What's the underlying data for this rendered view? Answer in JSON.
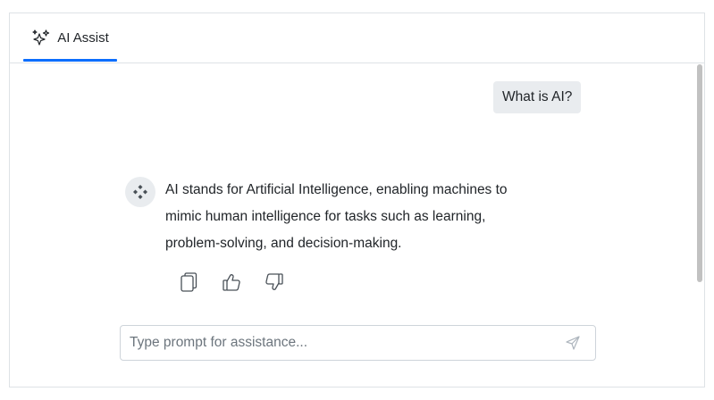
{
  "tab": {
    "label": "AI Assist",
    "icon": "sparkles-icon",
    "active_color": "#0d6efd"
  },
  "conversation": {
    "user_message": "What is AI?",
    "ai_avatar_icon": "ai-diamond-icon",
    "ai_response": "AI stands for Artificial Intelligence, enabling machines to\nmimic human intelligence for tasks such as learning,\nproblem-solving, and decision-making.",
    "actions": [
      {
        "name": "copy",
        "icon": "copy-icon"
      },
      {
        "name": "like",
        "icon": "thumbs-up-icon"
      },
      {
        "name": "dislike",
        "icon": "thumbs-down-icon"
      }
    ]
  },
  "prompt": {
    "placeholder": "Type prompt for assistance...",
    "value": "",
    "send_icon": "send-icon"
  }
}
